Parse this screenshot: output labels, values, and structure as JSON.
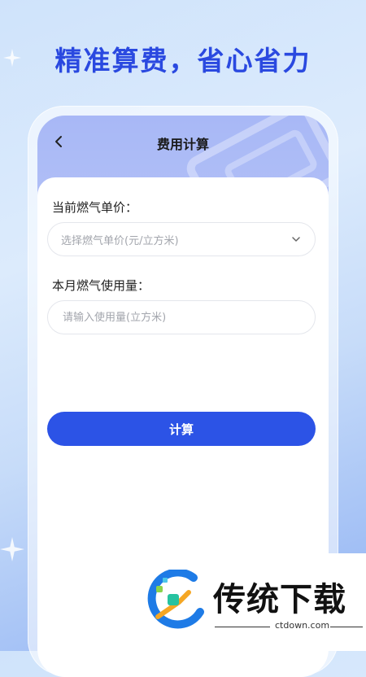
{
  "hero": {
    "title": "精准算费，省心省力"
  },
  "nav": {
    "title": "费用计算"
  },
  "form": {
    "price_label": "当前燃气单价：",
    "price_placeholder": "选择燃气单价(元/立方米)",
    "usage_label": "本月燃气使用量：",
    "usage_placeholder": "请输入使用量(立方米)",
    "submit_label": "计算"
  },
  "watermark": {
    "title": "传统下载",
    "url": "ctdown.com"
  },
  "colors": {
    "accent": "#2c53e6",
    "hero_text": "#2a49e0"
  }
}
